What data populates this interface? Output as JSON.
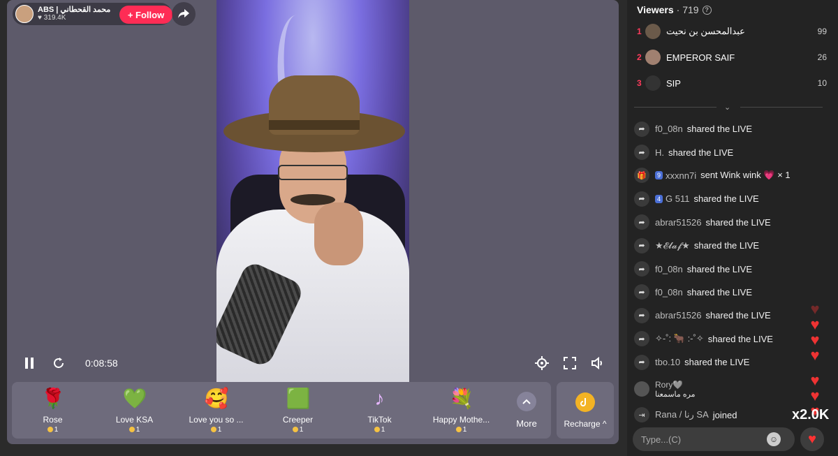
{
  "host": {
    "name": "ABS | محمد القحطاني",
    "likes": "319.4K",
    "follow_label": "+ Follow"
  },
  "player": {
    "time": "0:08:58"
  },
  "gifts": [
    {
      "name": "Rose",
      "icon": "🌹",
      "price": "1"
    },
    {
      "name": "Love KSA",
      "icon": "💚",
      "price": "1"
    },
    {
      "name": "Love you so ...",
      "icon": "🥰",
      "price": "1"
    },
    {
      "name": "Creeper",
      "icon": "🟩",
      "price": "1"
    },
    {
      "name": "TikTok",
      "icon": "♪",
      "price": "1"
    },
    {
      "name": "Happy Mothe...",
      "icon": "💐",
      "price": "1"
    }
  ],
  "more_label": "More",
  "recharge_label": "Recharge ^",
  "viewers": {
    "title": "Viewers",
    "count": "· 719",
    "top": [
      {
        "rank": "1",
        "name": "عبدالمحسن بن نحيت",
        "score": "99"
      },
      {
        "rank": "2",
        "name": "EMPEROR SAIF",
        "score": "26"
      },
      {
        "rank": "3",
        "name": "SIP",
        "score": "10"
      }
    ]
  },
  "chat": [
    {
      "user": "f0_08n",
      "action": "shared the LIVE"
    },
    {
      "user": "H.",
      "action": "shared the LIVE"
    },
    {
      "badge": "9",
      "user": "xxxnn7i",
      "action": "sent Wink wink 💗 × 1"
    },
    {
      "badge": "4",
      "user": "G 511",
      "action": "shared the LIVE"
    },
    {
      "user": "abrar51526",
      "action": "shared the LIVE"
    },
    {
      "user": "★𝓔𝓵𝓪𝓯★",
      "action": "shared the LIVE"
    },
    {
      "user": "f0_08n",
      "action": "shared the LIVE"
    },
    {
      "user": "f0_08n",
      "action": "shared the LIVE"
    },
    {
      "user": "abrar51526",
      "action": "shared the LIVE"
    },
    {
      "user": "✧-˚: 🐂 :-˚✧",
      "action": "shared the LIVE"
    },
    {
      "user": "tbo.10",
      "action": "shared the LIVE"
    }
  ],
  "comment": {
    "user": "Rory🩶",
    "text": "مره ماسمعنا"
  },
  "joined": {
    "user": "Rana / رنا SA",
    "action": "joined"
  },
  "multiplier": "x2.0K",
  "input_placeholder": "Type...(C)"
}
